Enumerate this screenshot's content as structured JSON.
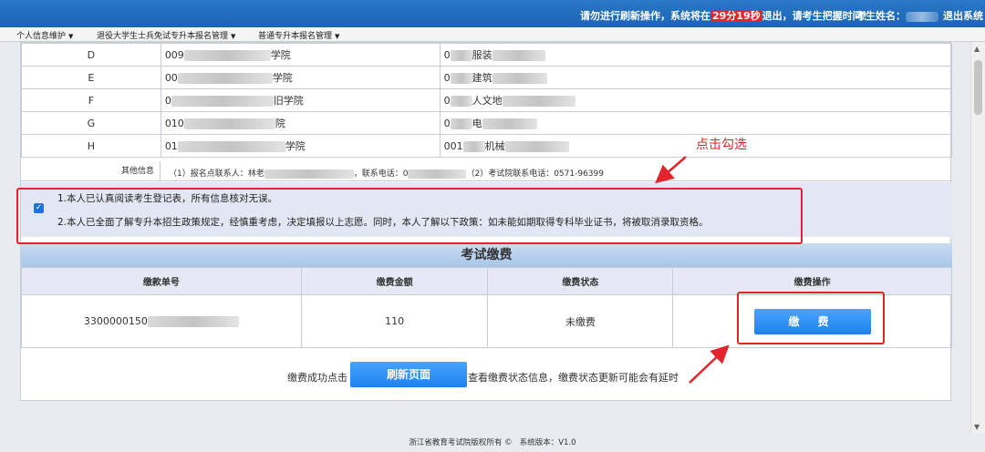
{
  "header": {
    "notice_pre": "请勿进行刷新操作，系统将在",
    "timer": "29分19秒",
    "notice_post": "退出，请考生把握时间！",
    "student_label": "考生姓名：",
    "logout": "退出系统"
  },
  "menu": [
    {
      "label": "个人信息维护"
    },
    {
      "label": "退役大学生士兵免试专升本报名管理"
    },
    {
      "label": "普通专升本报名管理"
    }
  ],
  "candidates": [
    {
      "letter": "D",
      "school1_code": "009",
      "school1_tail": "学院",
      "school2_code": "0",
      "school2_tail": "服装"
    },
    {
      "letter": "E",
      "school1_code": "00",
      "school1_tail": "学院",
      "school2_code": "0",
      "school2_tail": "建筑"
    },
    {
      "letter": "F",
      "school1_code": "0",
      "school1_tail": "旧学院",
      "school2_code": "0",
      "school2_tail": "人文地"
    },
    {
      "letter": "G",
      "school1_code": "010",
      "school1_tail": "院",
      "school2_code": "0",
      "school2_tail": "电"
    },
    {
      "letter": "H",
      "school1_code": "01",
      "school1_tail": "学院",
      "school2_code": "001",
      "school2_tail": "机械"
    }
  ],
  "other_info": {
    "label": "其他信息",
    "text_pre": "（1）报名点联系人：林老",
    "text_mid": "，联系电话：0",
    "text_post": "（2）考试院联系电话：0571-96399"
  },
  "agreement": {
    "checked": true,
    "line1": "1.本人已认真阅读考生登记表，所有信息核对无误。",
    "line2": "2.本人已全面了解专升本招生政策规定，经慎重考虑，决定填报以上志愿。同时，本人了解以下政策：如未能如期取得专科毕业证书，将被取消录取资格。"
  },
  "fee": {
    "title": "考试缴费",
    "columns": [
      "缴款单号",
      "缴费金额",
      "缴费状态",
      "缴费操作"
    ],
    "row": {
      "order_no": "3300000150",
      "amount": "110",
      "status": "未缴费",
      "action": "缴 费"
    }
  },
  "refresh": {
    "pre": "缴费成功点击",
    "button": "刷新页面",
    "post": "查看缴费状态信息，缴费状态更新可能会有延时"
  },
  "annotation": {
    "text": "点击勾选",
    "color": "#e3242b"
  },
  "footer": {
    "copyright": "浙江省教育考试院版权所有 ©",
    "version": "系统版本：V1.0"
  }
}
